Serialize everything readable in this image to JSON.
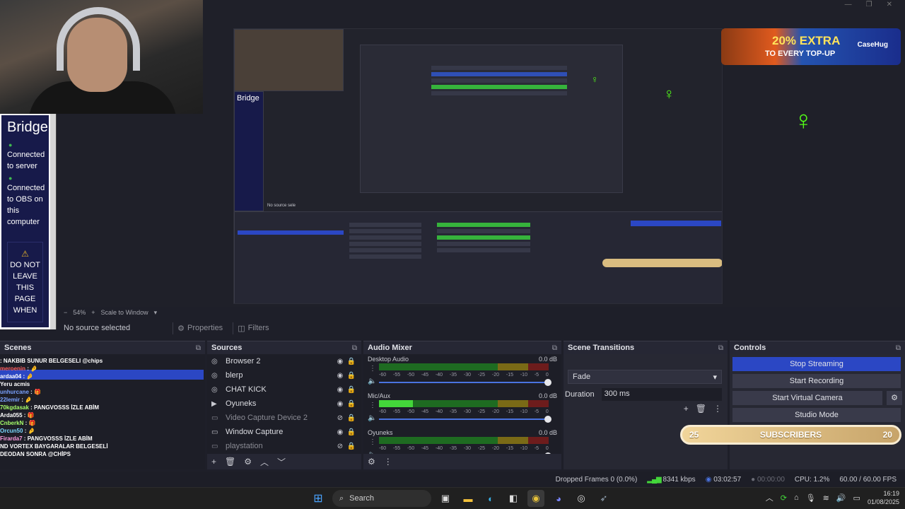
{
  "window_controls": [
    "—",
    "❐",
    "✕"
  ],
  "preview": {
    "bridge": {
      "title": "Bridge",
      "status1": "Connected to server",
      "status2": "Connected to OBS on this computer",
      "warning": "DO NOT LEAVE THIS PAGE WHEN"
    },
    "banner": {
      "headline": "20% EXTRA",
      "subline": "TO EVERY TOP-UP",
      "brand": "CaseHug"
    },
    "nested_text": {
      "bridge": "Bridge",
      "no_source": "No source sele",
      "scale": "Scale to Window"
    }
  },
  "scale_bar": {
    "minus": "−",
    "zoom": "54%",
    "plus": "+",
    "scale_mode": "Scale to Window"
  },
  "source_bar": {
    "no_source": "No source selected",
    "properties": "Properties",
    "filters": "Filters"
  },
  "docks": {
    "scenes": {
      "title": "Scenes",
      "chat": [
        {
          "user": "",
          "msg": ": NAKBIB SUNUR BELGESELI @chips",
          "color": "#ffffff"
        },
        {
          "user": "meroenin",
          "msg": " : 🤌",
          "color": "#ff5f5f"
        },
        {
          "user": "ardaa04",
          "msg": " : 🤌",
          "color": "#ffffff"
        },
        {
          "user": "",
          "msg": "Yeru acmis",
          "color": "#c8c9d0"
        },
        {
          "user": "unhurcane",
          "msg": " : 🎁",
          "color": "#7aa2ff"
        },
        {
          "user": "22lemir",
          "msg": " : 🤌",
          "color": "#7aa2ff"
        },
        {
          "user": "70kgdasak",
          "msg": " : PANGVOSSS İZLE ABİM",
          "color": "#a6ff6a"
        },
        {
          "user": "Arda055",
          "msg": " : 🎁",
          "color": "#ffffff"
        },
        {
          "user": "CnberkN",
          "msg": " : 🎁",
          "color": "#a6ff6a"
        },
        {
          "user": "Orcun50",
          "msg": " : 🤌",
          "color": "#7ad9ff"
        },
        {
          "user": "Firarda7",
          "msg": " : PANGVOSSS İZLE ABİM",
          "color": "#ff9ee0"
        },
        {
          "user": "",
          "msg": "ND VORTEX BAYGARALAR BELGESELİ",
          "color": "#ffffff"
        },
        {
          "user": "",
          "msg": "DEODAN SONRA @CHİPS",
          "color": "#ffffff"
        }
      ]
    },
    "sources": {
      "title": "Sources",
      "items": [
        {
          "name": "Browser 2",
          "icon": "◎",
          "dim": false
        },
        {
          "name": "blerp",
          "icon": "◎",
          "dim": false
        },
        {
          "name": "CHAT KICK",
          "icon": "◎",
          "dim": false
        },
        {
          "name": "Oyuneks",
          "icon": "▶",
          "dim": false
        },
        {
          "name": "Video Capture Device 2",
          "icon": "▭",
          "dim": true
        },
        {
          "name": "Window Capture",
          "icon": "▭",
          "dim": false
        },
        {
          "name": "playstation",
          "icon": "▭",
          "dim": true
        }
      ],
      "tools": [
        "+",
        "🗑",
        "⚙",
        "︿",
        "﹀"
      ]
    },
    "mixer": {
      "title": "Audio Mixer",
      "ticks": [
        "-60",
        "-55",
        "-50",
        "-45",
        "-40",
        "-35",
        "-30",
        "-25",
        "-20",
        "-15",
        "-10",
        "-5",
        "0"
      ],
      "channels": [
        {
          "name": "Desktop Audio",
          "db": "0.0 dB",
          "level": 0.0
        },
        {
          "name": "Mic/Aux",
          "db": "0.0 dB",
          "level": 0.2
        },
        {
          "name": "Oyuneks",
          "db": "0.0 dB",
          "level": 0.0
        }
      ]
    },
    "transitions": {
      "title": "Scene Transitions",
      "selected": "Fade",
      "duration_label": "Duration",
      "duration_value": "300 ms"
    },
    "controls": {
      "title": "Controls",
      "stop_streaming": "Stop Streaming",
      "start_recording": "Start Recording",
      "start_virtual_camera": "Start Virtual Camera",
      "studio_mode": "Studio Mode"
    },
    "subscribers": {
      "left": "25",
      "label": "SUBSCRIBERS",
      "right": "20"
    }
  },
  "status": {
    "dropped": "Dropped Frames 0 (0.0%)",
    "kbps": "8341 kbps",
    "stream_time": "03:02:57",
    "rec_time": "00:00:00",
    "cpu": "CPU: 1.2%",
    "fps": "60.00 / 60.00 FPS"
  },
  "taskbar": {
    "search": "Search",
    "time": "16:19",
    "date": "01/08/2025"
  },
  "colors": {
    "accent": "#2b47c4",
    "kick_green": "#53fc18",
    "meter_green": "#43d63a"
  }
}
